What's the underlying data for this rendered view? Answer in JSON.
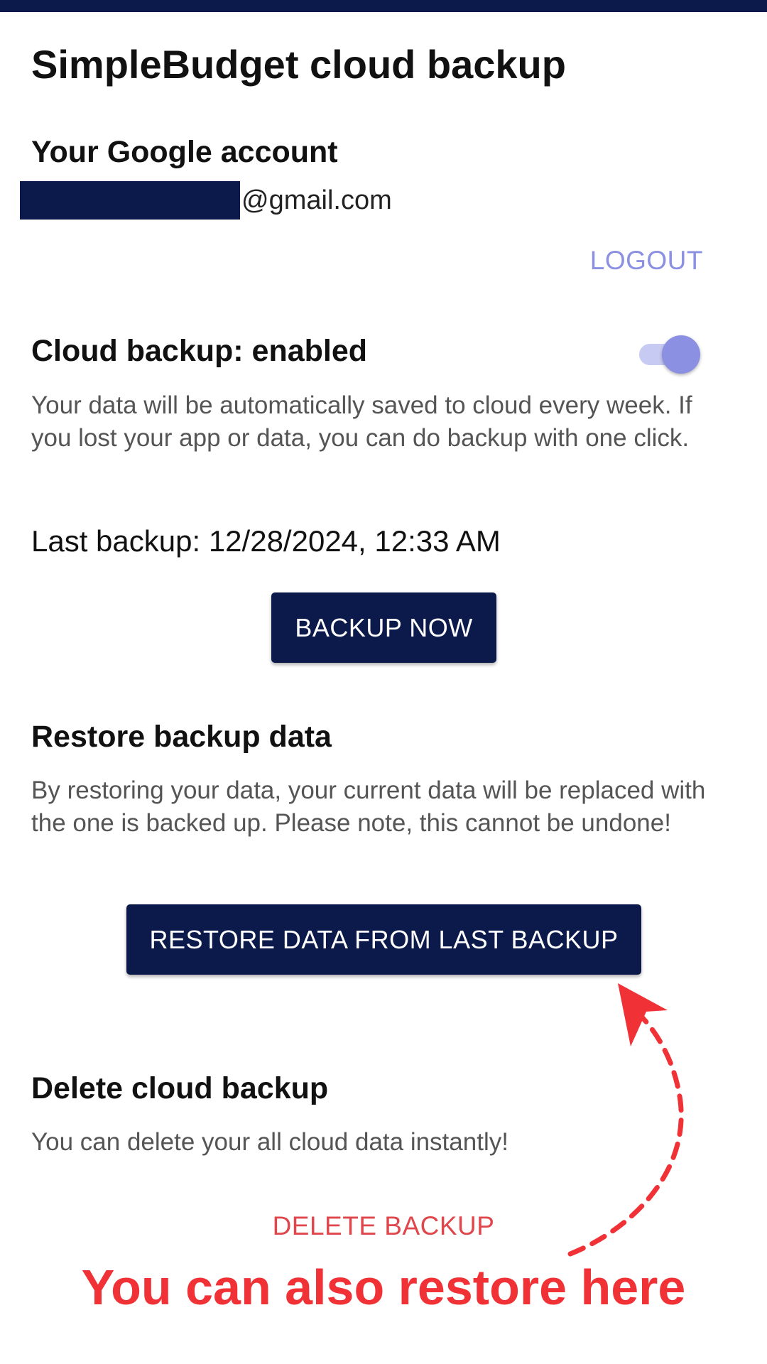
{
  "screen": {
    "title": "SimpleBudget cloud backup"
  },
  "account": {
    "heading": "Your Google account",
    "email_suffix": "@gmail.com",
    "logout_label": "LOGOUT"
  },
  "cloud_backup": {
    "heading": "Cloud backup: enabled",
    "enabled": true,
    "description": "Your data will be automatically saved to cloud every week. If you lost your app or data, you can do backup with one click.",
    "last_backup": "Last backup: 12/28/2024, 12:33 AM",
    "backup_now_label": "BACKUP NOW"
  },
  "restore": {
    "heading": "Restore backup data",
    "description": "By restoring your data, your current data will be replaced with the one is backed up. Please note, this cannot be undone!",
    "button_label": "RESTORE DATA FROM LAST BACKUP"
  },
  "delete": {
    "heading": "Delete cloud backup",
    "description": "You can delete your all cloud data instantly!",
    "button_label": "DELETE BACKUP"
  },
  "annotation": {
    "text": "You can also restore here",
    "arrow_icon": "dashed-curved-arrow-icon"
  },
  "colors": {
    "primary": "#0b1a4a",
    "accent": "#8b90e2",
    "danger": "#e0474c",
    "annotation": "#f03237"
  }
}
